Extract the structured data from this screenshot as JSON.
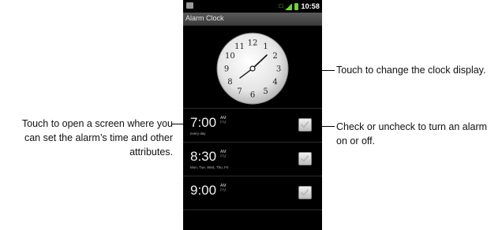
{
  "status_bar": {
    "time": "10:58"
  },
  "app": {
    "title": "Alarm Clock"
  },
  "clock": {
    "numerals": [
      "12",
      "1",
      "2",
      "3",
      "4",
      "5",
      "6",
      "7",
      "8",
      "9",
      "10",
      "11"
    ]
  },
  "alarms": [
    {
      "time": "7:00",
      "am": "AM",
      "pm": "PM",
      "days": "every day",
      "enabled": false
    },
    {
      "time": "8:30",
      "am": "AM",
      "pm": "PM",
      "days": "Mon, Tue, Wed, Thu, Fri",
      "enabled": false
    },
    {
      "time": "9:00",
      "am": "AM",
      "pm": "PM",
      "days": "",
      "enabled": false
    }
  ],
  "callouts": {
    "clock_display": "Touch to change the clock display.",
    "checkbox_line1": "Check or uncheck to turn an alarm",
    "checkbox_line2": "on or off.",
    "open_line1": "Touch to open a screen where you",
    "open_line2": "can set the alarm’s time and other",
    "open_line3": "attributes."
  }
}
